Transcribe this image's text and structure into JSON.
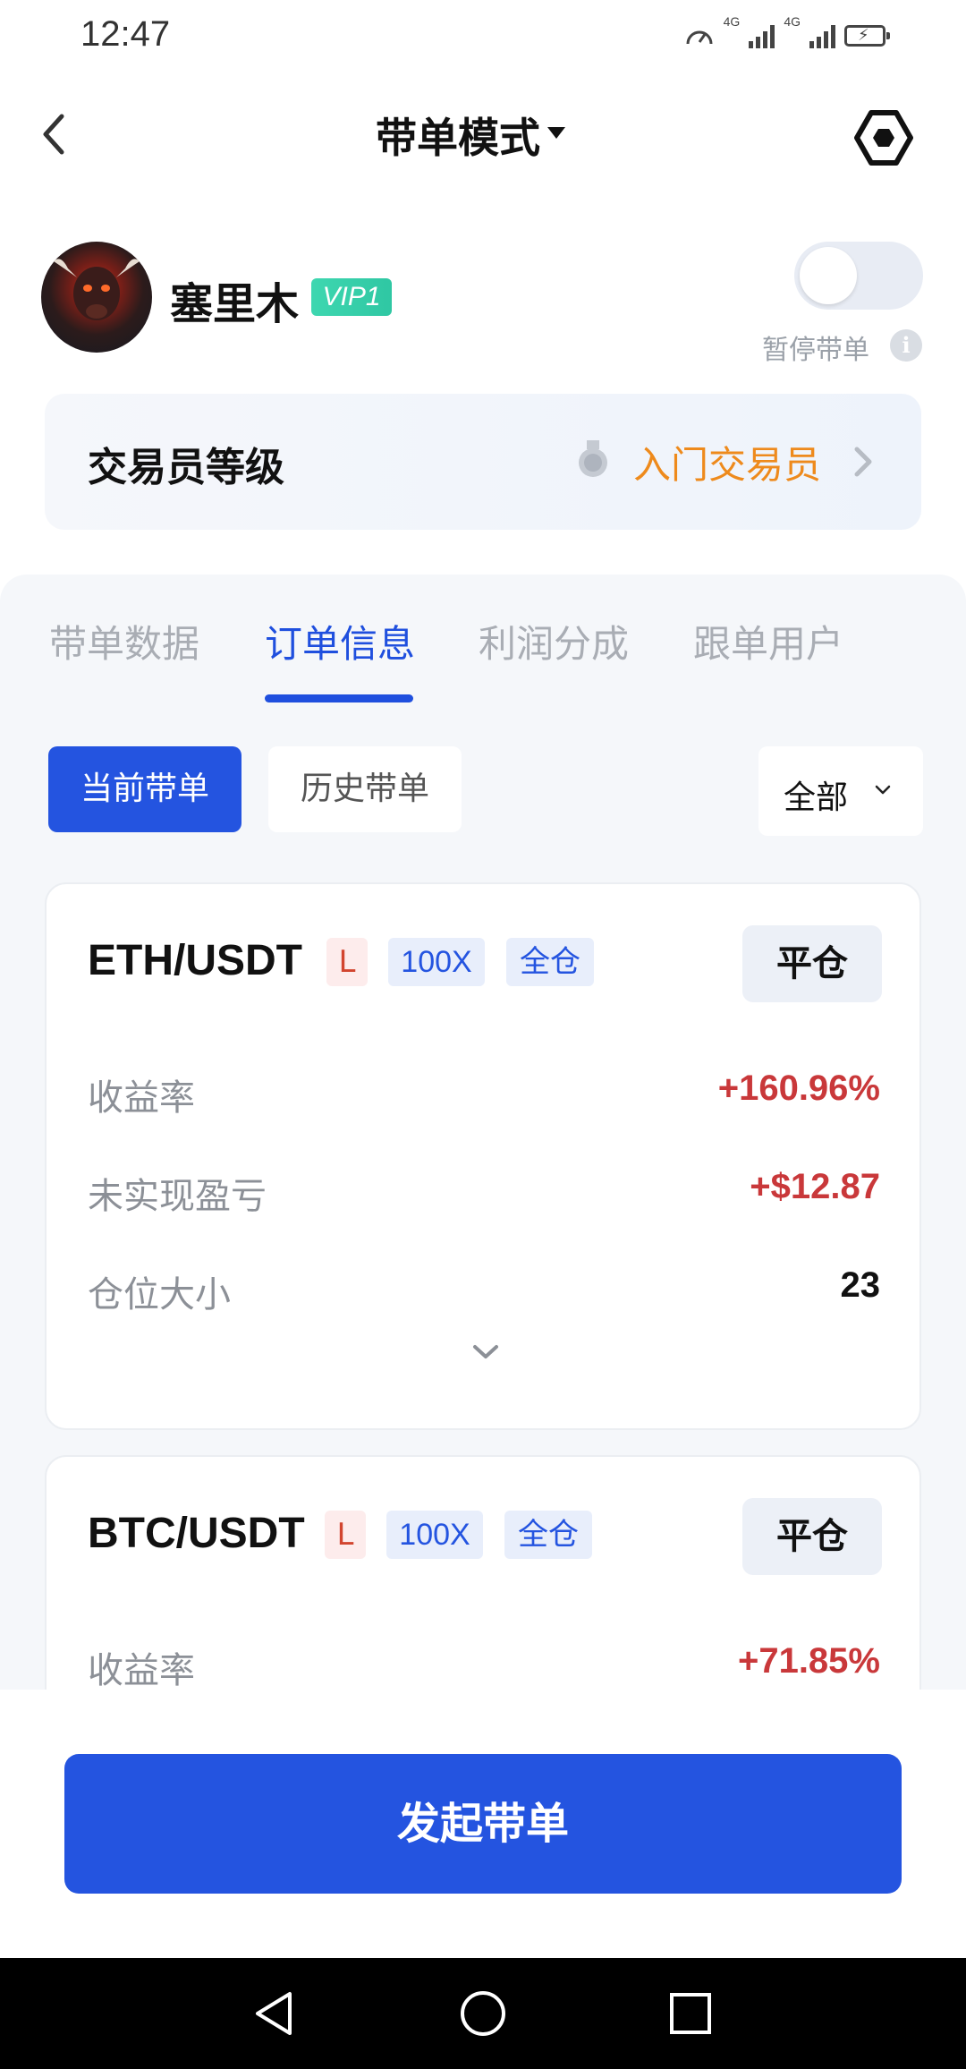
{
  "status_bar": {
    "time": "12:47",
    "network_1": "4G",
    "network_2": "4G",
    "icons": [
      "speed-icon",
      "signal-icon",
      "signal-icon",
      "battery-charging-icon"
    ]
  },
  "header": {
    "title": "带单模式",
    "icons": [
      "back-chevron-icon",
      "dropdown-caret-icon",
      "hexagon-settings-icon"
    ]
  },
  "profile": {
    "name": "塞里木",
    "vip": "VIP1",
    "pause_label": "暂停带单",
    "toggle_on": false
  },
  "trader_level": {
    "label": "交易员等级",
    "value": "入门交易员"
  },
  "tabs": [
    {
      "label": "带单数据",
      "active": false
    },
    {
      "label": "订单信息",
      "active": true
    },
    {
      "label": "利润分成",
      "active": false
    },
    {
      "label": "跟单用户",
      "active": false
    }
  ],
  "subtabs": {
    "current": "当前带单",
    "history": "历史带单",
    "filter": "全部"
  },
  "orders": [
    {
      "pair": "ETH/USDT",
      "side": "L",
      "leverage": "100X",
      "mode": "全仓",
      "close_label": "平仓",
      "rows": [
        {
          "label": "收益率",
          "value": "+160.96%"
        },
        {
          "label": "未实现盈亏",
          "value": "+$12.87"
        },
        {
          "label": "仓位大小",
          "value": "23"
        }
      ]
    },
    {
      "pair": "BTC/USDT",
      "side": "L",
      "leverage": "100X",
      "mode": "全仓",
      "close_label": "平仓",
      "rows": [
        {
          "label": "收益率",
          "value": "+71.85%"
        }
      ]
    }
  ],
  "primary_action": "发起带单",
  "colors": {
    "accent": "#2454e0",
    "profit": "#c9383a",
    "level": "#ee8a1c",
    "vip": "#2fc7a3"
  }
}
